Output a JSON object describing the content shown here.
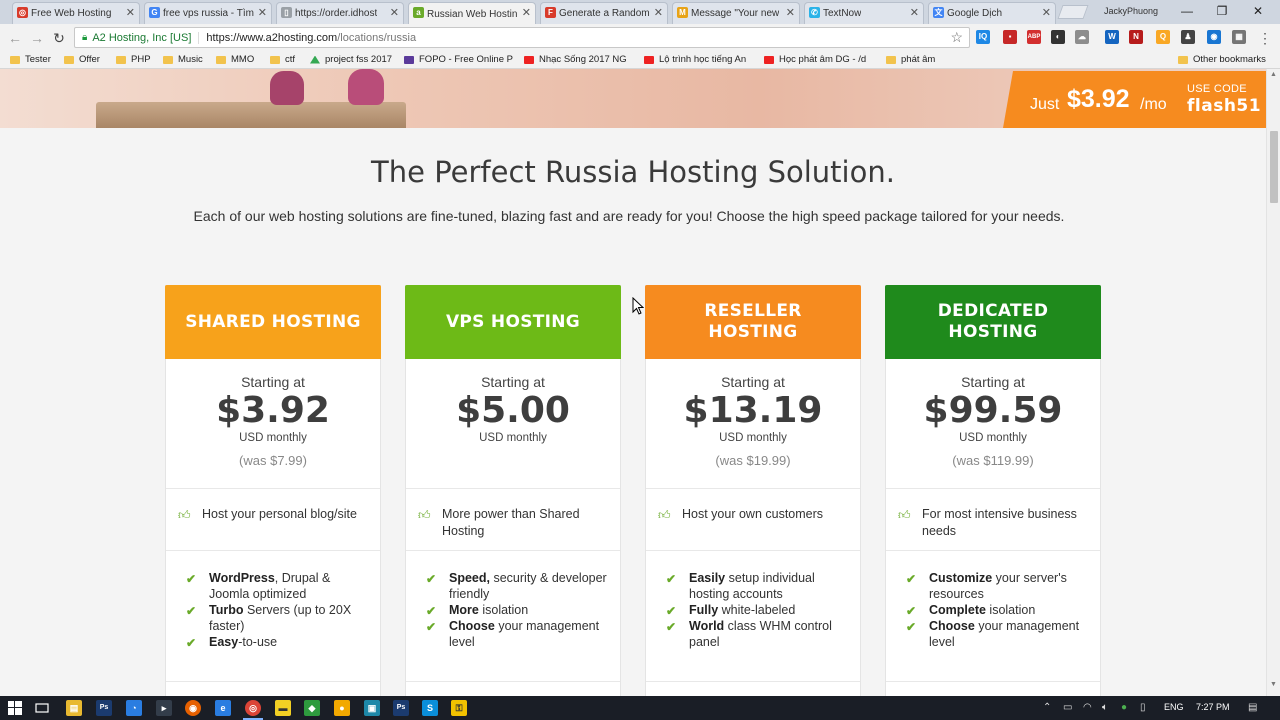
{
  "tabs": [
    {
      "label": "Free Web Hosting",
      "icon": "red-favicon",
      "color": "#d83b2b"
    },
    {
      "label": "free vps russia - Tìm",
      "icon": "google-favicon",
      "color": "#4285f4"
    },
    {
      "label": "https://order.idhost",
      "icon": "page-favicon",
      "color": "#9aa0a6"
    },
    {
      "label": "Russian Web Hostin",
      "icon": "a2-favicon",
      "color": "#6aaa2a"
    },
    {
      "label": "Generate a Random",
      "icon": "f-favicon",
      "color": "#d83b2b"
    },
    {
      "label": "Message \"Your new",
      "icon": "gmail-favicon",
      "color": "#e8a317"
    },
    {
      "label": "TextNow",
      "icon": "textnow-favicon",
      "color": "#2bb3e8"
    },
    {
      "label": "Google Dịch",
      "icon": "translate-favicon",
      "color": "#4285f4"
    }
  ],
  "profile_name": "JackyPhuong",
  "window": {
    "minimize": "—",
    "restore": "❐",
    "close": "✕"
  },
  "address": {
    "site_identity": "A2 Hosting, Inc [US]",
    "url_host": "https://www.a2hosting.com",
    "url_path": "/locations/russia"
  },
  "extensions": [
    {
      "name": "iq-icon",
      "label": "IQ",
      "color": "#1e88e5"
    },
    {
      "name": "red-ext-icon",
      "label": "▪",
      "color": "#c62828"
    },
    {
      "name": "abp-icon",
      "label": "ABP",
      "color": "#d32f2f"
    },
    {
      "name": "spy-icon",
      "label": "◐",
      "color": "#333333"
    },
    {
      "name": "cloud-ext-icon",
      "label": "☁",
      "color": "#8d8d8d"
    },
    {
      "name": "w-ext-icon",
      "label": "W",
      "color": "#1565c0"
    },
    {
      "name": "n-ext-icon",
      "label": "N",
      "color": "#b71c1c"
    },
    {
      "name": "q-ext-icon",
      "label": "Q",
      "color": "#f9a825"
    },
    {
      "name": "person-ext-icon",
      "label": "♟",
      "color": "#444444"
    },
    {
      "name": "blue-ext-icon",
      "label": "◉",
      "color": "#1976d2"
    },
    {
      "name": "grid-ext-icon",
      "label": "▦",
      "color": "#757575"
    }
  ],
  "bookmarks": [
    {
      "label": "Tester",
      "type": "folder"
    },
    {
      "label": "Offer",
      "type": "folder"
    },
    {
      "label": "PHP",
      "type": "folder"
    },
    {
      "label": "Music",
      "type": "folder"
    },
    {
      "label": "MMO",
      "type": "folder"
    },
    {
      "label": "ctf",
      "type": "folder"
    },
    {
      "label": "project fss 2017",
      "type": "drive"
    },
    {
      "label": "FOPO - Free Online P",
      "type": "fopo"
    },
    {
      "label": "Nhạc Sống 2017 NG",
      "type": "youtube"
    },
    {
      "label": "Lộ trình học tiếng An",
      "type": "youtube"
    },
    {
      "label": "Học phát âm DG - /d",
      "type": "youtube"
    },
    {
      "label": "phát âm",
      "type": "folder"
    }
  ],
  "other_bookmarks": "Other bookmarks",
  "promo": {
    "just": "Just",
    "price": "$3.92",
    "per": "/mo",
    "use_code": "USE CODE",
    "code": "flash51"
  },
  "headline": "The Perfect Russia Hosting Solution.",
  "subhead": "Each of our web hosting solutions are fine-tuned, blazing fast and are ready for you! Choose the high speed package tailored for your needs.",
  "plans": [
    {
      "title": "SHARED HOSTING",
      "color": "#f7a21b",
      "starting": "Starting at",
      "price": "$3.92",
      "unit": "USD monthly",
      "was": "(was $7.99)",
      "tagline": "Host your personal blog/site",
      "features": [
        {
          "bold": "WordPress",
          "rest": ", Drupal & Joomla optimized"
        },
        {
          "bold": "Turbo",
          "rest": " Servers (up to 20X faster)"
        },
        {
          "bold": "Easy",
          "rest": "-to-use"
        }
      ]
    },
    {
      "title": "VPS HOSTING",
      "color": "#6dba17",
      "starting": "Starting at",
      "price": "$5.00",
      "unit": "USD monthly",
      "was": "",
      "tagline": "More power than Shared Hosting",
      "features": [
        {
          "bold": "Speed,",
          "rest": " security & developer friendly"
        },
        {
          "bold": "More",
          "rest": " isolation"
        },
        {
          "bold": "Choose",
          "rest": " your management level"
        }
      ]
    },
    {
      "title": "RESELLER HOSTING",
      "color": "#f68b1f",
      "starting": "Starting at",
      "price": "$13.19",
      "unit": "USD monthly",
      "was": "(was $19.99)",
      "tagline": "Host your own customers",
      "features": [
        {
          "bold": "Easily",
          "rest": " setup individual hosting accounts"
        },
        {
          "bold": "Fully",
          "rest": " white-labeled"
        },
        {
          "bold": "World",
          "rest": " class WHM control panel"
        }
      ]
    },
    {
      "title": "DEDICATED HOSTING",
      "color": "#1f8a1c",
      "starting": "Starting at",
      "price": "$99.59",
      "unit": "USD monthly",
      "was": "(was $119.99)",
      "tagline": "For most intensive business needs",
      "features": [
        {
          "bold": "Customize",
          "rest": " your server's resources"
        },
        {
          "bold": "Complete",
          "rest": " isolation"
        },
        {
          "bold": "Choose",
          "rest": " your management level"
        }
      ]
    }
  ],
  "taskbar": {
    "apps": [
      {
        "name": "explorer-icon",
        "label": "▤",
        "color": "#e8b931"
      },
      {
        "name": "photoshop-icon",
        "label": "Ps",
        "color": "#1b3b6f"
      },
      {
        "name": "chat-icon",
        "label": "◔",
        "color": "#2a7de1"
      },
      {
        "name": "terminal-icon",
        "label": "▸",
        "color": "#333d4a"
      },
      {
        "name": "firefox-icon",
        "label": "◉",
        "color": "#e66000"
      },
      {
        "name": "edge-icon",
        "label": "e",
        "color": "#2a7de1"
      },
      {
        "name": "chrome-icon",
        "label": "◎",
        "color": "#db4437"
      },
      {
        "name": "notes-icon",
        "label": "▬",
        "color": "#f2d024"
      },
      {
        "name": "green-app-icon",
        "label": "◆",
        "color": "#2e9b3e"
      },
      {
        "name": "bulb-icon",
        "label": "●",
        "color": "#f2a900"
      },
      {
        "name": "box-icon",
        "label": "▣",
        "color": "#1e88a8"
      },
      {
        "name": "photoshop2-icon",
        "label": "Ps",
        "color": "#1b3b6f"
      },
      {
        "name": "skype-icon",
        "label": "S",
        "color": "#0a8ed9"
      },
      {
        "name": "vpn-icon",
        "label": "⚿",
        "color": "#f2c200"
      }
    ],
    "lang": "ENG",
    "time": "7:27 PM"
  }
}
